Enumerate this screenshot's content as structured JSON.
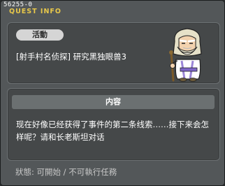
{
  "window": {
    "quest_id": "56255-0",
    "title": "QUEST INFO"
  },
  "quest": {
    "category_tag": "活動",
    "name": "[射手村名侦探] 研究黑独眼兽3",
    "npc_icon": "elder-sage-npc"
  },
  "details": {
    "header": "内容",
    "description": "现在好像已经获得了事件的第二条线索……接下来会怎样呢？请和长老斯坦对话"
  },
  "footer": {
    "status": "狀態: 可開始 / 不可執行任務"
  },
  "colors": {
    "window_bg": "#535759",
    "panel_bg": "#454849",
    "title_accent": "#e8c84a",
    "section_header_bg": "#6b7071"
  }
}
